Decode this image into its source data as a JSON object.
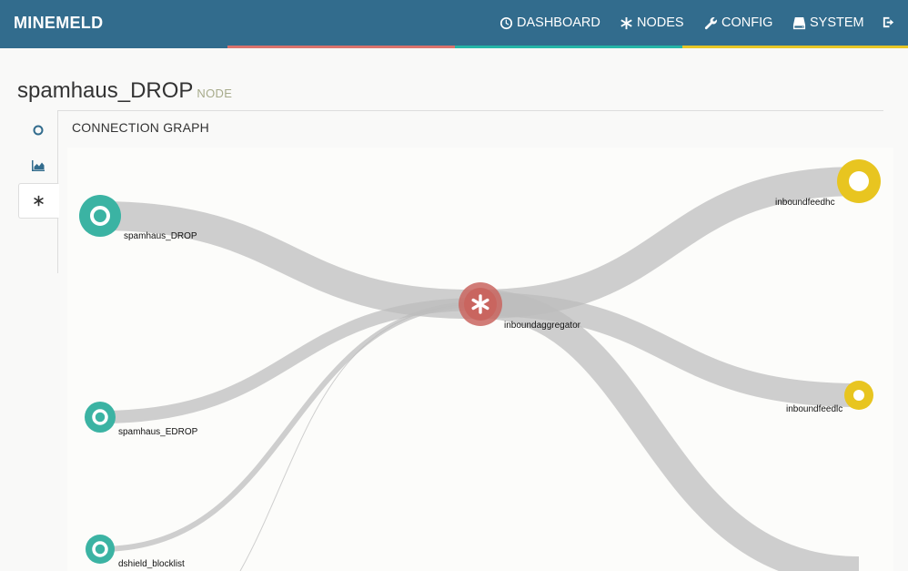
{
  "navbar": {
    "brand": "MINEMELD",
    "items": [
      {
        "label": "DASHBOARD",
        "icon": "dashboard-icon"
      },
      {
        "label": "NODES",
        "icon": "asterisk-icon"
      },
      {
        "label": "CONFIG",
        "icon": "wrench-icon"
      },
      {
        "label": "SYSTEM",
        "icon": "hdd-icon"
      },
      {
        "label": "",
        "icon": "logout-icon"
      }
    ],
    "stripe_colors": [
      "#d9736d",
      "#26b5a7",
      "#e6c626"
    ]
  },
  "page": {
    "title": "spamhaus_DROP",
    "subtitle": "NODE"
  },
  "tabs": [
    {
      "icon": "circle-icon",
      "active": false
    },
    {
      "icon": "area-chart-icon",
      "active": false
    },
    {
      "icon": "asterisk-icon",
      "active": true
    }
  ],
  "panel": {
    "title": "CONNECTION GRAPH"
  },
  "graph": {
    "nodes": {
      "spamhaus_drop": "spamhaus_DROP",
      "spamhaus_edrop": "spamhaus_EDROP",
      "dshield_blocklist": "dshield_blocklist",
      "inboundaggregator": "inboundaggregator",
      "inboundfeedhc": "inboundfeedhc",
      "inboundfeedlc": "inboundfeedlc"
    },
    "colors": {
      "miner": "#3bb3a3",
      "processor": "#c9655f",
      "output": "#e8c520",
      "link": "#bdbdbd"
    }
  }
}
